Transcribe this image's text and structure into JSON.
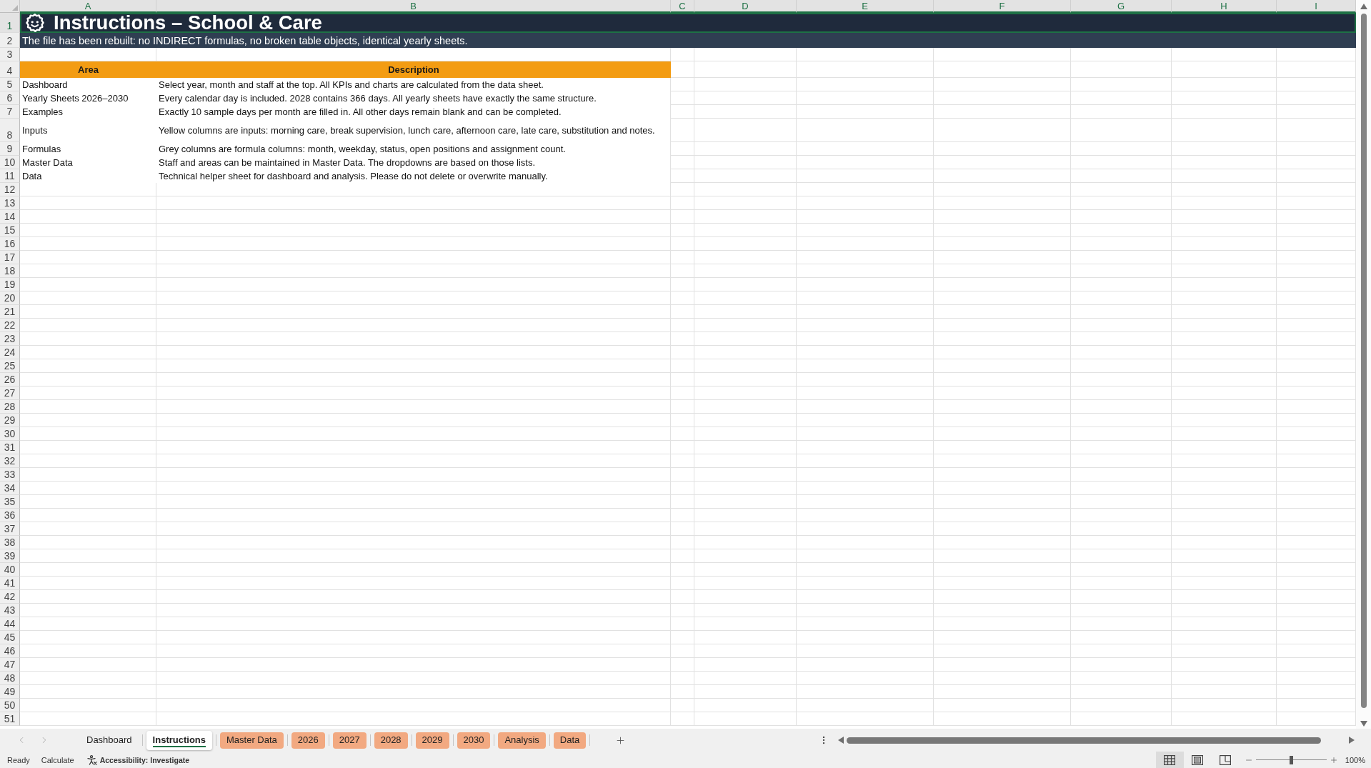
{
  "column_headers": [
    {
      "label": "A",
      "selected": true
    },
    {
      "label": "B",
      "selected": true
    },
    {
      "label": "C",
      "selected": true
    },
    {
      "label": "D",
      "selected": true
    },
    {
      "label": "E",
      "selected": true
    },
    {
      "label": "F",
      "selected": true
    },
    {
      "label": "G",
      "selected": true
    },
    {
      "label": "H",
      "selected": true
    },
    {
      "label": "I",
      "selected": true
    }
  ],
  "row_headers": [
    {
      "label": "1",
      "selected": true
    },
    {
      "label": "2",
      "selected": false
    },
    {
      "label": "3",
      "selected": false
    },
    {
      "label": "4",
      "selected": false
    },
    {
      "label": "5",
      "selected": false
    },
    {
      "label": "6",
      "selected": false
    },
    {
      "label": "7",
      "selected": false
    },
    {
      "label": "8",
      "selected": false
    },
    {
      "label": "9",
      "selected": false
    },
    {
      "label": "10",
      "selected": false
    },
    {
      "label": "11",
      "selected": false
    },
    {
      "label": "12",
      "selected": false
    },
    {
      "label": "13",
      "selected": false
    },
    {
      "label": "14",
      "selected": false
    },
    {
      "label": "15",
      "selected": false
    },
    {
      "label": "16",
      "selected": false
    },
    {
      "label": "17",
      "selected": false
    },
    {
      "label": "18",
      "selected": false
    },
    {
      "label": "19",
      "selected": false
    },
    {
      "label": "20",
      "selected": false
    },
    {
      "label": "21",
      "selected": false
    },
    {
      "label": "22",
      "selected": false
    },
    {
      "label": "23",
      "selected": false
    },
    {
      "label": "24",
      "selected": false
    },
    {
      "label": "25",
      "selected": false
    },
    {
      "label": "26",
      "selected": false
    },
    {
      "label": "27",
      "selected": false
    },
    {
      "label": "28",
      "selected": false
    },
    {
      "label": "29",
      "selected": false
    },
    {
      "label": "30",
      "selected": false
    },
    {
      "label": "31",
      "selected": false
    },
    {
      "label": "32",
      "selected": false
    },
    {
      "label": "33",
      "selected": false
    },
    {
      "label": "34",
      "selected": false
    },
    {
      "label": "35",
      "selected": false
    },
    {
      "label": "36",
      "selected": false
    },
    {
      "label": "37",
      "selected": false
    },
    {
      "label": "38",
      "selected": false
    },
    {
      "label": "39",
      "selected": false
    },
    {
      "label": "40",
      "selected": false
    },
    {
      "label": "41",
      "selected": false
    },
    {
      "label": "42",
      "selected": false
    },
    {
      "label": "43",
      "selected": false
    },
    {
      "label": "44",
      "selected": false
    },
    {
      "label": "45",
      "selected": false
    },
    {
      "label": "46",
      "selected": false
    },
    {
      "label": "47",
      "selected": false
    },
    {
      "label": "48",
      "selected": false
    },
    {
      "label": "49",
      "selected": false
    },
    {
      "label": "50",
      "selected": false
    },
    {
      "label": "51",
      "selected": false
    }
  ],
  "title_row": {
    "text": "Instructions – School & Care",
    "selected": true
  },
  "note_row": {
    "text": "The file has been rebuilt: no INDIRECT formulas, no broken table objects, identical yearly sheets."
  },
  "table": {
    "columns": [
      "Area",
      "Description"
    ],
    "rows": [
      {
        "area": "Dashboard",
        "description": "Select year, month and staff at the top. All KPIs and charts are calculated from the data sheet."
      },
      {
        "area": "Yearly Sheets 2026–2030",
        "description": "Every calendar day is included. 2028 contains 366 days. All yearly sheets have exactly the same structure."
      },
      {
        "area": "Examples",
        "description": "Exactly 10 sample days per month are filled in. All other days remain blank and can be completed."
      },
      {
        "area": "Inputs",
        "description": "Yellow columns are inputs: morning care, break supervision, lunch care, afternoon care, late care, substitution and notes."
      },
      {
        "area": "Formulas",
        "description": "Grey columns are formula columns: month, weekday, status, open positions and assignment count."
      },
      {
        "area": "Master Data",
        "description": "Staff and areas can be maintained in Master Data. The dropdowns are based on those lists."
      },
      {
        "area": "Data",
        "description": "Technical helper sheet for dashboard and analysis. Please do not delete or overwrite manually."
      }
    ]
  },
  "sheet_tabs": [
    {
      "label": "Dashboard",
      "selected": false
    },
    {
      "label": "Instructions",
      "selected": true
    },
    {
      "label": "Master Data",
      "selected": false,
      "color": "#f2a981"
    },
    {
      "label": "2026",
      "selected": false,
      "color": "#f2a981"
    },
    {
      "label": "2027",
      "selected": false,
      "color": "#f2a981"
    },
    {
      "label": "2028",
      "selected": false,
      "color": "#f2a981"
    },
    {
      "label": "2029",
      "selected": false,
      "color": "#f2a981"
    },
    {
      "label": "2030",
      "selected": false,
      "color": "#f2a981"
    },
    {
      "label": "Analysis",
      "selected": false,
      "color": "#f2a981"
    },
    {
      "label": "Data",
      "selected": false,
      "color": "#f2a981"
    }
  ],
  "status_bar": {
    "mode": "Ready",
    "calculate": "Calculate",
    "accessibility": "Accessibility: Investigate",
    "views": [
      {
        "kind": "normal",
        "selected": true
      },
      {
        "kind": "page_layout",
        "selected": false
      },
      {
        "kind": "page_break",
        "selected": false
      }
    ],
    "zoom": {
      "level": 0.5,
      "reading": "100%"
    }
  }
}
